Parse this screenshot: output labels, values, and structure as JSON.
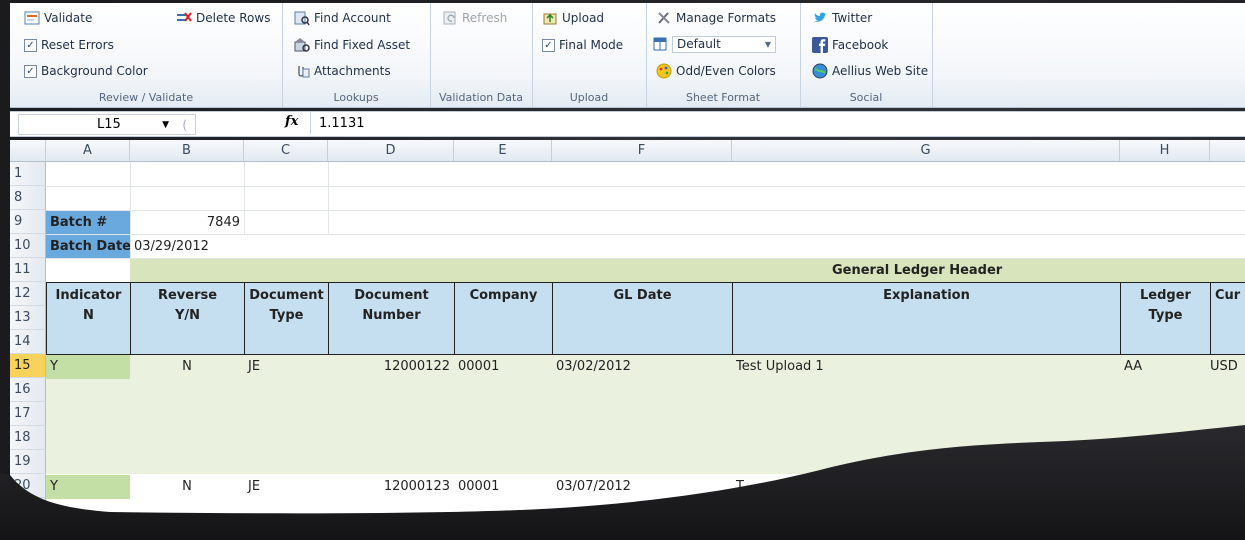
{
  "ribbon": {
    "groups": [
      {
        "title": "Review / Validate",
        "items": [
          {
            "label": "Validate",
            "icon": "validate-icon"
          },
          {
            "label": "Reset Errors",
            "checked": true
          },
          {
            "label": "Background Color",
            "checked": true
          },
          {
            "label": "Delete Rows",
            "icon": "delete-rows-icon"
          }
        ]
      },
      {
        "title": "Lookups",
        "items": [
          {
            "label": "Find Account",
            "icon": "find-account-icon"
          },
          {
            "label": "Find Fixed Asset",
            "icon": "find-fixed-asset-icon"
          },
          {
            "label": "Attachments",
            "icon": "attachments-icon"
          }
        ]
      },
      {
        "title": "Validation Data",
        "items": [
          {
            "label": "Refresh",
            "icon": "refresh-icon",
            "disabled": true
          }
        ]
      },
      {
        "title": "Upload",
        "items": [
          {
            "label": "Upload",
            "icon": "upload-icon"
          },
          {
            "label": "Final Mode",
            "checked": true
          }
        ]
      },
      {
        "title": "Sheet Format",
        "items": [
          {
            "label": "Manage Formats",
            "icon": "manage-formats-icon"
          },
          {
            "label": "Default",
            "icon": "format-icon"
          },
          {
            "label": "Odd/Even Colors",
            "icon": "odd-even-colors-icon"
          }
        ]
      },
      {
        "title": "Social",
        "items": [
          {
            "label": "Twitter",
            "icon": "twitter-icon"
          },
          {
            "label": "Facebook",
            "icon": "facebook-icon"
          },
          {
            "label": "Aellius Web Site",
            "icon": "web-site-icon"
          }
        ]
      }
    ]
  },
  "formula_bar": {
    "cell_ref": "L15",
    "fx": "fx",
    "value": "1.1131"
  },
  "columns": [
    "A",
    "B",
    "C",
    "D",
    "E",
    "F",
    "G",
    "H"
  ],
  "rows": [
    "1",
    "8",
    "9",
    "10",
    "11",
    "12",
    "13",
    "14",
    "15",
    "16",
    "17",
    "18",
    "19",
    "20"
  ],
  "batch": {
    "number_label": "Batch #",
    "number_value": "7849",
    "date_label": "Batch Date",
    "date_value": "03/29/2012"
  },
  "banner": "General Ledger Header",
  "headers": [
    {
      "line1": "Indicator",
      "line2": "N"
    },
    {
      "line1": "Reverse",
      "line2": "Y/N"
    },
    {
      "line1": "Document",
      "line2": "Type"
    },
    {
      "line1": "Document",
      "line2": "Number"
    },
    {
      "line1": "Company",
      "line2": ""
    },
    {
      "line1": "GL Date",
      "line2": ""
    },
    {
      "line1": "Explanation",
      "line2": ""
    },
    {
      "line1": "Ledger",
      "line2": "Type"
    },
    {
      "line1": "Cur",
      "line2": ""
    }
  ],
  "records": [
    {
      "indicator": "Y",
      "reverse": "N",
      "doc_type": "JE",
      "doc_number": "12000122",
      "company": "00001",
      "gl_date": "03/02/2012",
      "explanation": "Test Upload 1",
      "ledger_type": "AA",
      "currency": "USD"
    },
    {
      "indicator": "Y",
      "reverse": "N",
      "doc_type": "JE",
      "doc_number": "12000123",
      "company": "00001",
      "gl_date": "03/07/2012",
      "explanation": "T",
      "ledger_type": "",
      "currency": ""
    }
  ]
}
